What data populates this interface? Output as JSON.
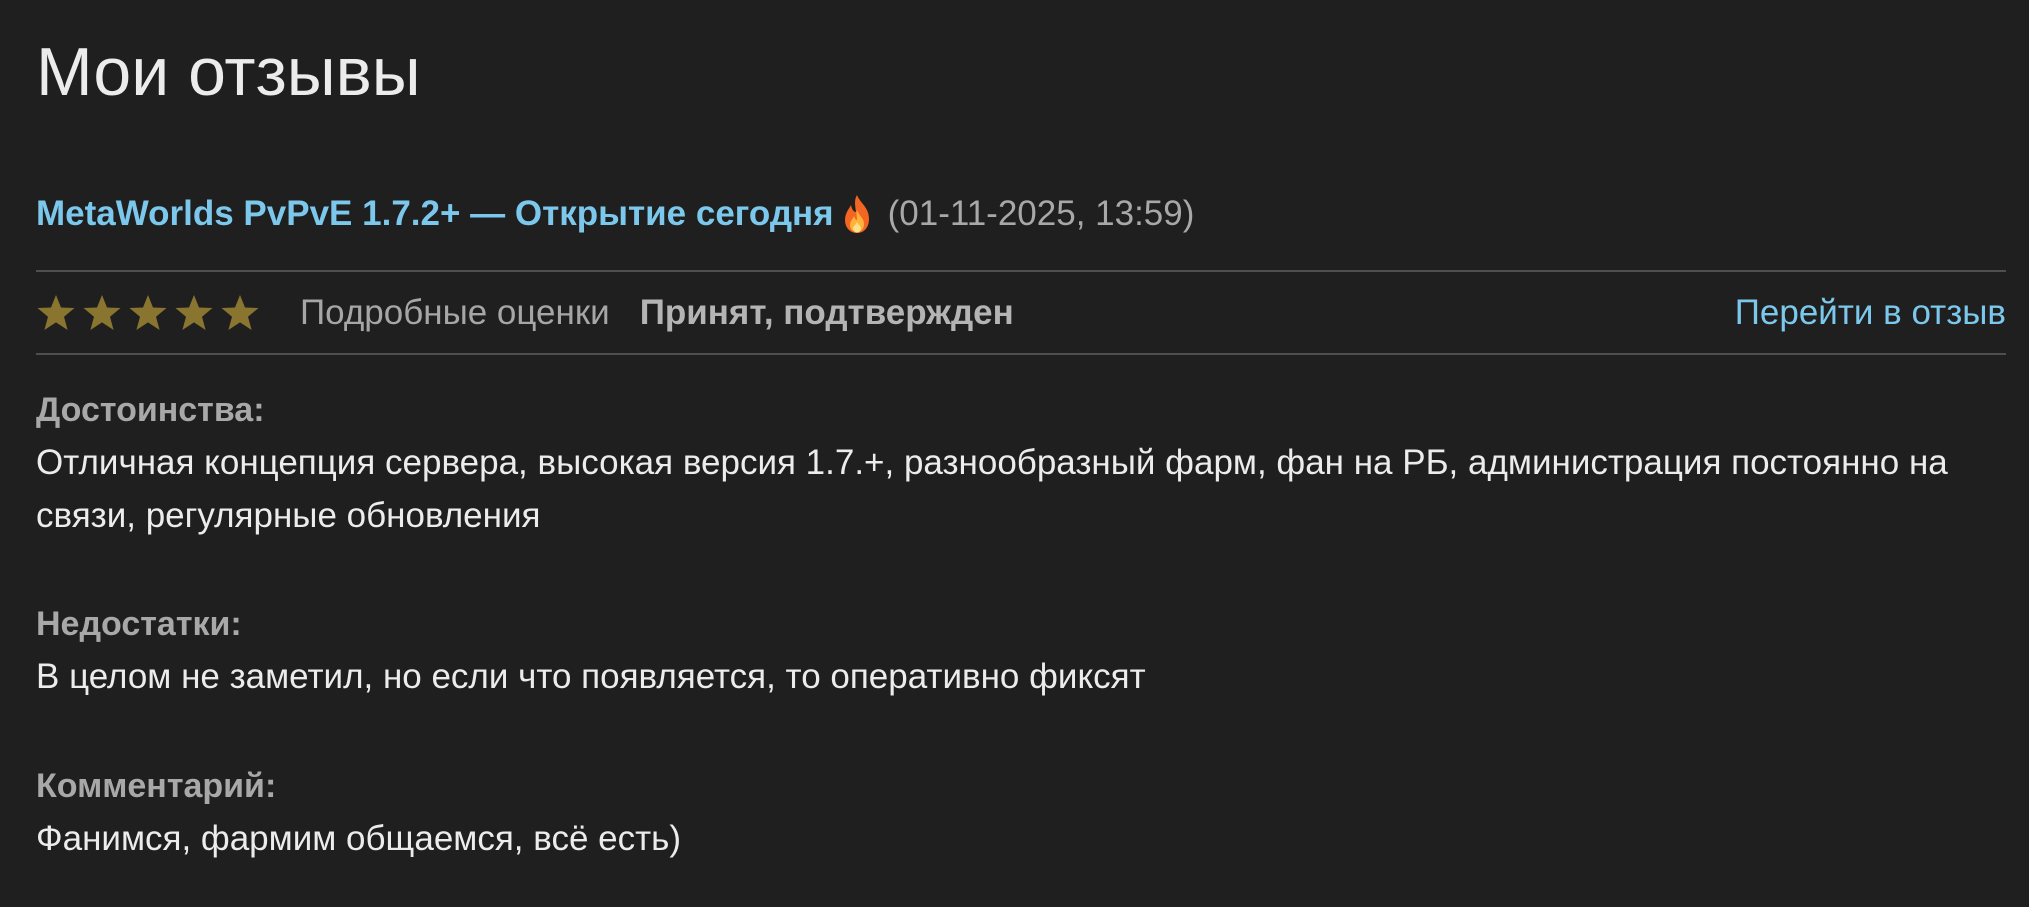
{
  "page": {
    "title": "Мои отзывы"
  },
  "review": {
    "server_name": "MetaWorlds PvPvE 1.7.2+ — Открытие сегодня",
    "server_icon": "fire-icon",
    "date": "(01-11-2025, 13:59)",
    "rating": {
      "value": 5,
      "max": 5,
      "icon": "star-icon"
    },
    "ratings_details_label": "Подробные оценки",
    "status": "Принят, подтвержден",
    "goto_label": "Перейти в отзыв",
    "pros": {
      "label": "Достоинства:",
      "text": "Отличная концепция сервера, высокая версия 1.7.+, разнообразный фарм, фан на РБ, администрация постоянно на связи, регулярные обновления"
    },
    "cons": {
      "label": "Недостатки:",
      "text": "В целом не заметил, но если что появляется, то оперативно фиксят"
    },
    "comment": {
      "label": "Комментарий:",
      "text": "Фанимся, фармим общаемся, всё есть)"
    }
  },
  "colors": {
    "background": "#1f1f1f",
    "link": "#7cc8ec",
    "star": "#8a7530",
    "muted_text": "#a8a8a8",
    "divider": "#4e4e4e"
  }
}
